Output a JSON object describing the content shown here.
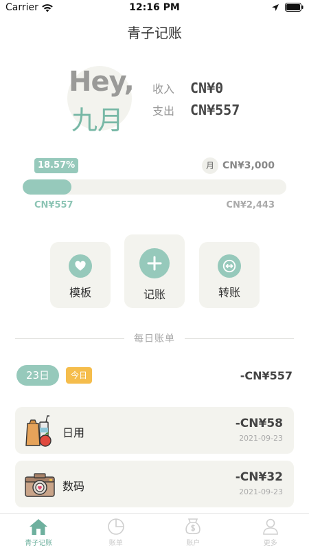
{
  "status_bar": {
    "carrier": "Carrier",
    "time": "12:16 PM"
  },
  "nav": {
    "title": "青子记账"
  },
  "greeting": {
    "hey": "Hey,",
    "name": "九月"
  },
  "summary": {
    "income_label": "收入",
    "income_value": "CN¥0",
    "expense_label": "支出",
    "expense_value": "CN¥557"
  },
  "budget": {
    "percent_label": "18.57%",
    "percent_value": 0.1857,
    "period": "月",
    "total": "CN¥3,000",
    "spent": "CN¥557",
    "remaining": "CN¥2,443"
  },
  "actions": [
    {
      "label": "模板",
      "icon": "heart-icon"
    },
    {
      "label": "记账",
      "icon": "plus-icon"
    },
    {
      "label": "转账",
      "icon": "transfer-icon"
    }
  ],
  "daily": {
    "section_title": "每日账单",
    "date": "23日",
    "today_label": "今日",
    "day_total": "-CN¥557",
    "records": [
      {
        "name": "日用",
        "amount": "-CN¥58",
        "date": "2021-09-23",
        "icon": "groceries-icon"
      },
      {
        "name": "数码",
        "amount": "-CN¥32",
        "date": "2021-09-23",
        "icon": "camera-icon"
      }
    ]
  },
  "tabs": [
    {
      "label": "青子记账",
      "icon": "home-icon",
      "active": true
    },
    {
      "label": "账单",
      "icon": "pie-chart-icon",
      "active": false
    },
    {
      "label": "账户",
      "icon": "money-bag-icon",
      "active": false
    },
    {
      "label": "更多",
      "icon": "person-icon",
      "active": false
    }
  ],
  "colors": {
    "accent": "#96c9bb",
    "accent_dark": "#6eb09e",
    "card": "#f3f3ee",
    "today_badge": "#f5bd4c"
  }
}
